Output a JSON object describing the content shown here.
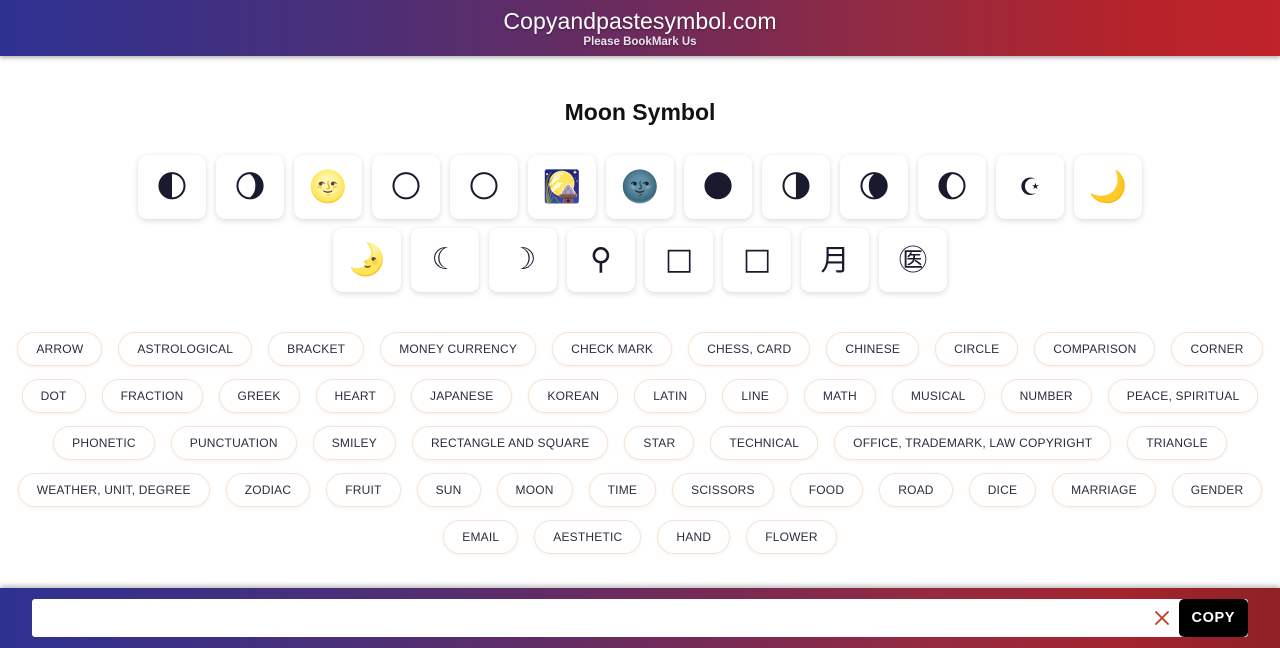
{
  "header": {
    "title": "Copyandpastesymbol.com",
    "subtitle": "Please BookMark Us",
    "gradient_start": "#2e3192",
    "gradient_end": "#c0232a"
  },
  "page_title": "Moon Symbol",
  "symbol_rows": [
    [
      {
        "glyph": "🌓",
        "name": "first-quarter-moon",
        "style": "emoji"
      },
      {
        "glyph": "🌖",
        "name": "waning-gibbous-moon",
        "style": "emoji"
      },
      {
        "glyph": "🌝",
        "name": "full-moon-face",
        "style": "emoji"
      },
      {
        "glyph": "🌕",
        "name": "full-moon",
        "style": "emoji"
      },
      {
        "glyph": "🌕",
        "name": "full-moon-alt",
        "style": "emoji"
      },
      {
        "glyph": "🎑",
        "name": "moon-viewing-ceremony",
        "style": "emoji"
      },
      {
        "glyph": "🌚",
        "name": "new-moon-face",
        "style": "emoji"
      },
      {
        "glyph": "🌑",
        "name": "new-moon",
        "style": "emoji"
      },
      {
        "glyph": "🌗",
        "name": "last-quarter-moon",
        "style": "emoji"
      },
      {
        "glyph": "🌘",
        "name": "waning-crescent-moon",
        "style": "emoji"
      },
      {
        "glyph": "🌔",
        "name": "waxing-gibbous-moon",
        "style": "emoji"
      },
      {
        "glyph": "☪",
        "name": "star-and-crescent",
        "style": "small"
      },
      {
        "glyph": "🌙",
        "name": "crescent-moon",
        "style": "emoji"
      }
    ],
    [
      {
        "glyph": "🌛",
        "name": "first-quarter-moon-face",
        "style": "emoji"
      },
      {
        "glyph": "☾",
        "name": "last-quarter-moon-sign",
        "style": "glyph"
      },
      {
        "glyph": "☽",
        "name": "first-quarter-moon-sign",
        "style": "glyph"
      },
      {
        "glyph": "⚲",
        "name": "crescent-cross-sign",
        "style": "glyph"
      },
      {
        "glyph": "□",
        "name": "missing-glyph-box-1",
        "style": "glyph"
      },
      {
        "glyph": "□",
        "name": "missing-glyph-box-2",
        "style": "glyph"
      },
      {
        "glyph": "月",
        "name": "cjk-moon-character",
        "style": "cjk"
      },
      {
        "glyph": "㊩",
        "name": "circled-cjk-moon",
        "style": "cjk"
      }
    ]
  ],
  "category_rows": [
    [
      "ARROW",
      "ASTROLOGICAL",
      "BRACKET",
      "MONEY CURRENCY",
      "CHECK MARK",
      "CHESS, CARD",
      "CHINESE",
      "CIRCLE",
      "COMPARISON",
      "CORNER"
    ],
    [
      "DOT",
      "FRACTION",
      "GREEK",
      "HEART",
      "JAPANESE",
      "KOREAN",
      "LATIN",
      "LINE",
      "MATH",
      "MUSICAL",
      "NUMBER",
      "PEACE, SPIRITUAL"
    ],
    [
      "PHONETIC",
      "PUNCTUATION",
      "SMILEY",
      "RECTANGLE AND SQUARE",
      "STAR",
      "TECHNICAL",
      "OFFICE, TRADEMARK, LAW COPYRIGHT",
      "TRIANGLE"
    ],
    [
      "WEATHER, UNIT, DEGREE",
      "ZODIAC",
      "FRUIT",
      "SUN",
      "MOON",
      "TIME",
      "SCISSORS",
      "FOOD",
      "ROAD",
      "DICE",
      "MARRIAGE",
      "GENDER"
    ],
    [
      "EMAIL",
      "AESTHETIC",
      "HAND",
      "FLOWER"
    ]
  ],
  "bottom_bar": {
    "input_value": "",
    "input_placeholder": "",
    "clear_icon": "close-x-icon",
    "clear_icon_color": "#c0392b",
    "copy_label": "COPY",
    "copy_bg": "#000000"
  }
}
